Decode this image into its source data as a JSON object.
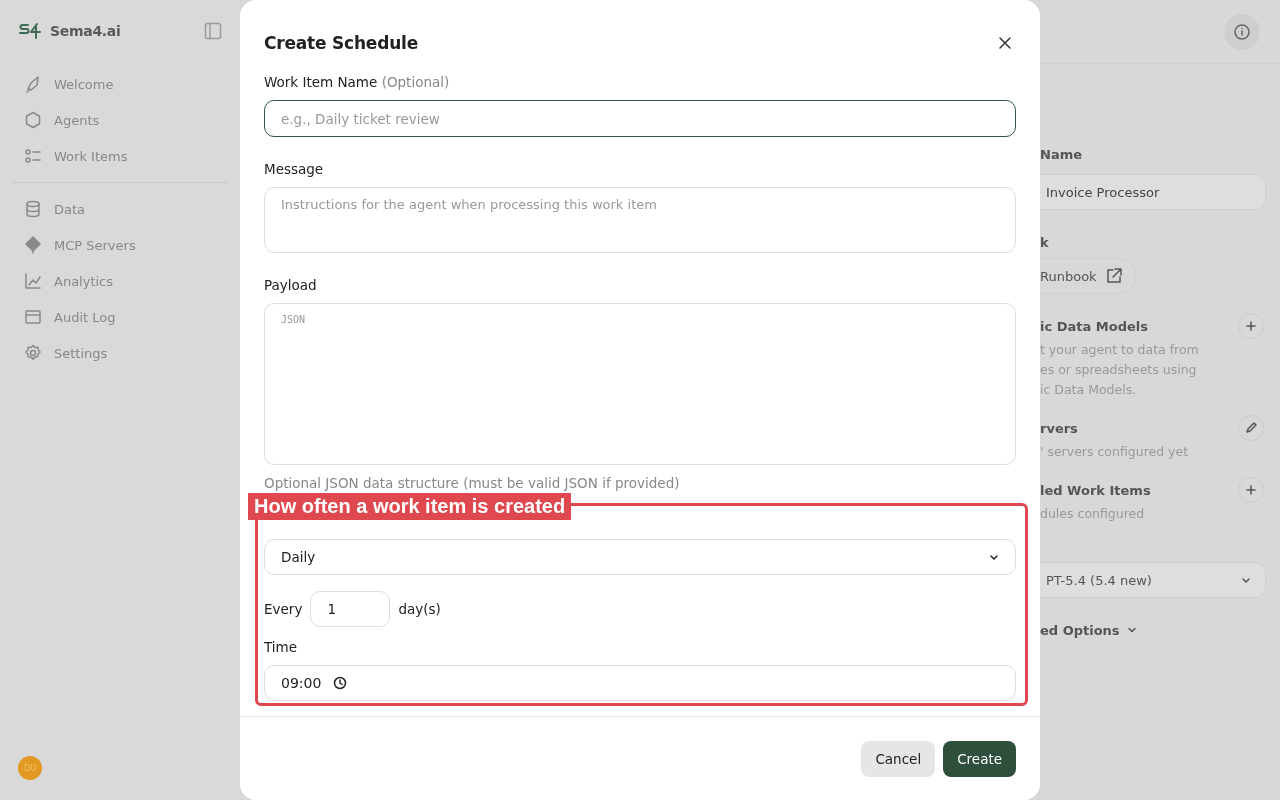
{
  "sidebar": {
    "brand": "Sema4.ai",
    "groups": [
      [
        {
          "label": "Welcome"
        },
        {
          "label": "Agents"
        },
        {
          "label": "Work Items"
        }
      ],
      [
        {
          "label": "Data"
        },
        {
          "label": "MCP Servers"
        },
        {
          "label": "Analytics"
        },
        {
          "label": "Audit Log"
        },
        {
          "label": "Settings"
        }
      ]
    ],
    "avatar": "DU"
  },
  "background_panel": {
    "sections": [
      {
        "kind": "field",
        "title": "Name",
        "value": "Invoice Processor"
      },
      {
        "kind": "link",
        "title": "k",
        "value": "Runbook"
      },
      {
        "kind": "add_section",
        "title": "ic Data Models",
        "lines": [
          "t your agent to data from",
          "es or spreadsheets using",
          "ic Data Models."
        ]
      },
      {
        "kind": "edit_section",
        "title": "rvers",
        "lines": [
          "' servers configured yet"
        ]
      },
      {
        "kind": "add_section",
        "title": "led Work Items",
        "lines": [
          "dules configured"
        ]
      },
      {
        "kind": "select",
        "value": "PT-5.4 (5.4 new)"
      },
      {
        "kind": "toggle",
        "title": "ed Options"
      }
    ]
  },
  "modal": {
    "title": "Create Schedule",
    "work_item_name": {
      "label": "Work Item Name",
      "optional": "(Optional)",
      "placeholder": "e.g., Daily ticket review",
      "focused": true
    },
    "message": {
      "label": "Message",
      "placeholder": "Instructions for the agent when processing this work item"
    },
    "payload": {
      "label": "Payload",
      "placeholder": "JSON",
      "hint": "Optional JSON data structure (must be valid JSON if provided)"
    },
    "frequency": {
      "value": "Daily"
    },
    "every": {
      "label": "Every",
      "value": "1",
      "unit": "day(s)"
    },
    "time": {
      "label": "Time",
      "value": "09:00"
    },
    "buttons": [
      {
        "label": "Cancel",
        "kind": "secondary"
      },
      {
        "label": "Create",
        "kind": "primary"
      }
    ]
  },
  "annotation": {
    "label": "How often a work item is created"
  }
}
